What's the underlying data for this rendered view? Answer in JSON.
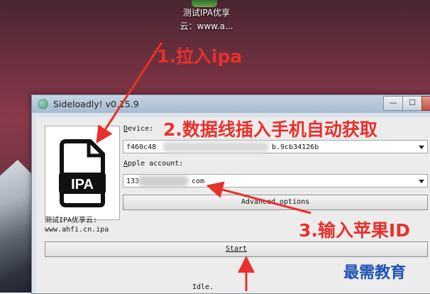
{
  "desktop_icon": {
    "label_line1": "测试IPA优享",
    "label_line2": "云：www.a..."
  },
  "window": {
    "title": "Sideloadly! v0.15.9",
    "controls": {
      "minimize": "—",
      "maximize": "☐",
      "close": ""
    }
  },
  "form": {
    "device_label_pre": "",
    "device_label_key": "D",
    "device_label_rest": "evice:",
    "device_value_start": "f460c48",
    "device_value_end": "b.9cb34126b",
    "apple_label_key": "A",
    "apple_label_rest": "pple account:",
    "apple_value_start": "133",
    "apple_value_end": "com",
    "advanced_button": "Advanced options",
    "start_button": "Start",
    "status": "Idle."
  },
  "ipa_icon": {
    "text": "IPA"
  },
  "sidebar": {
    "line1": "测试IPA优享云:",
    "line2": "www.ahfi.cn.ipa"
  },
  "annotations": {
    "step1": "1.拉入ipa",
    "step2": "2.数据线插入手机自动获取",
    "step3": "3.输入苹果ID"
  },
  "watermark": "最需教育",
  "colors": {
    "annotation_red": "#e8312b",
    "watermark_blue": "#1e52b4"
  }
}
